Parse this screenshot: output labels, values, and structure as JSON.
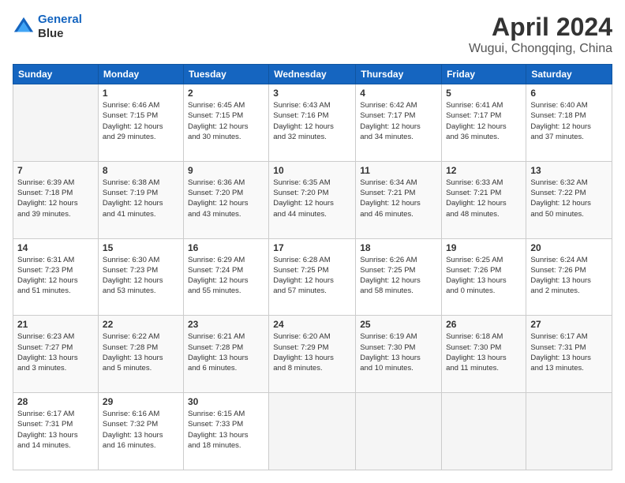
{
  "header": {
    "logo_line1": "General",
    "logo_line2": "Blue",
    "title": "April 2024",
    "subtitle": "Wugui, Chongqing, China"
  },
  "columns": [
    "Sunday",
    "Monday",
    "Tuesday",
    "Wednesday",
    "Thursday",
    "Friday",
    "Saturday"
  ],
  "weeks": [
    [
      {
        "day": "",
        "info": ""
      },
      {
        "day": "1",
        "info": "Sunrise: 6:46 AM\nSunset: 7:15 PM\nDaylight: 12 hours\nand 29 minutes."
      },
      {
        "day": "2",
        "info": "Sunrise: 6:45 AM\nSunset: 7:15 PM\nDaylight: 12 hours\nand 30 minutes."
      },
      {
        "day": "3",
        "info": "Sunrise: 6:43 AM\nSunset: 7:16 PM\nDaylight: 12 hours\nand 32 minutes."
      },
      {
        "day": "4",
        "info": "Sunrise: 6:42 AM\nSunset: 7:17 PM\nDaylight: 12 hours\nand 34 minutes."
      },
      {
        "day": "5",
        "info": "Sunrise: 6:41 AM\nSunset: 7:17 PM\nDaylight: 12 hours\nand 36 minutes."
      },
      {
        "day": "6",
        "info": "Sunrise: 6:40 AM\nSunset: 7:18 PM\nDaylight: 12 hours\nand 37 minutes."
      }
    ],
    [
      {
        "day": "7",
        "info": "Sunrise: 6:39 AM\nSunset: 7:18 PM\nDaylight: 12 hours\nand 39 minutes."
      },
      {
        "day": "8",
        "info": "Sunrise: 6:38 AM\nSunset: 7:19 PM\nDaylight: 12 hours\nand 41 minutes."
      },
      {
        "day": "9",
        "info": "Sunrise: 6:36 AM\nSunset: 7:20 PM\nDaylight: 12 hours\nand 43 minutes."
      },
      {
        "day": "10",
        "info": "Sunrise: 6:35 AM\nSunset: 7:20 PM\nDaylight: 12 hours\nand 44 minutes."
      },
      {
        "day": "11",
        "info": "Sunrise: 6:34 AM\nSunset: 7:21 PM\nDaylight: 12 hours\nand 46 minutes."
      },
      {
        "day": "12",
        "info": "Sunrise: 6:33 AM\nSunset: 7:21 PM\nDaylight: 12 hours\nand 48 minutes."
      },
      {
        "day": "13",
        "info": "Sunrise: 6:32 AM\nSunset: 7:22 PM\nDaylight: 12 hours\nand 50 minutes."
      }
    ],
    [
      {
        "day": "14",
        "info": "Sunrise: 6:31 AM\nSunset: 7:23 PM\nDaylight: 12 hours\nand 51 minutes."
      },
      {
        "day": "15",
        "info": "Sunrise: 6:30 AM\nSunset: 7:23 PM\nDaylight: 12 hours\nand 53 minutes."
      },
      {
        "day": "16",
        "info": "Sunrise: 6:29 AM\nSunset: 7:24 PM\nDaylight: 12 hours\nand 55 minutes."
      },
      {
        "day": "17",
        "info": "Sunrise: 6:28 AM\nSunset: 7:25 PM\nDaylight: 12 hours\nand 57 minutes."
      },
      {
        "day": "18",
        "info": "Sunrise: 6:26 AM\nSunset: 7:25 PM\nDaylight: 12 hours\nand 58 minutes."
      },
      {
        "day": "19",
        "info": "Sunrise: 6:25 AM\nSunset: 7:26 PM\nDaylight: 13 hours\nand 0 minutes."
      },
      {
        "day": "20",
        "info": "Sunrise: 6:24 AM\nSunset: 7:26 PM\nDaylight: 13 hours\nand 2 minutes."
      }
    ],
    [
      {
        "day": "21",
        "info": "Sunrise: 6:23 AM\nSunset: 7:27 PM\nDaylight: 13 hours\nand 3 minutes."
      },
      {
        "day": "22",
        "info": "Sunrise: 6:22 AM\nSunset: 7:28 PM\nDaylight: 13 hours\nand 5 minutes."
      },
      {
        "day": "23",
        "info": "Sunrise: 6:21 AM\nSunset: 7:28 PM\nDaylight: 13 hours\nand 6 minutes."
      },
      {
        "day": "24",
        "info": "Sunrise: 6:20 AM\nSunset: 7:29 PM\nDaylight: 13 hours\nand 8 minutes."
      },
      {
        "day": "25",
        "info": "Sunrise: 6:19 AM\nSunset: 7:30 PM\nDaylight: 13 hours\nand 10 minutes."
      },
      {
        "day": "26",
        "info": "Sunrise: 6:18 AM\nSunset: 7:30 PM\nDaylight: 13 hours\nand 11 minutes."
      },
      {
        "day": "27",
        "info": "Sunrise: 6:17 AM\nSunset: 7:31 PM\nDaylight: 13 hours\nand 13 minutes."
      }
    ],
    [
      {
        "day": "28",
        "info": "Sunrise: 6:17 AM\nSunset: 7:31 PM\nDaylight: 13 hours\nand 14 minutes."
      },
      {
        "day": "29",
        "info": "Sunrise: 6:16 AM\nSunset: 7:32 PM\nDaylight: 13 hours\nand 16 minutes."
      },
      {
        "day": "30",
        "info": "Sunrise: 6:15 AM\nSunset: 7:33 PM\nDaylight: 13 hours\nand 18 minutes."
      },
      {
        "day": "",
        "info": ""
      },
      {
        "day": "",
        "info": ""
      },
      {
        "day": "",
        "info": ""
      },
      {
        "day": "",
        "info": ""
      }
    ]
  ]
}
